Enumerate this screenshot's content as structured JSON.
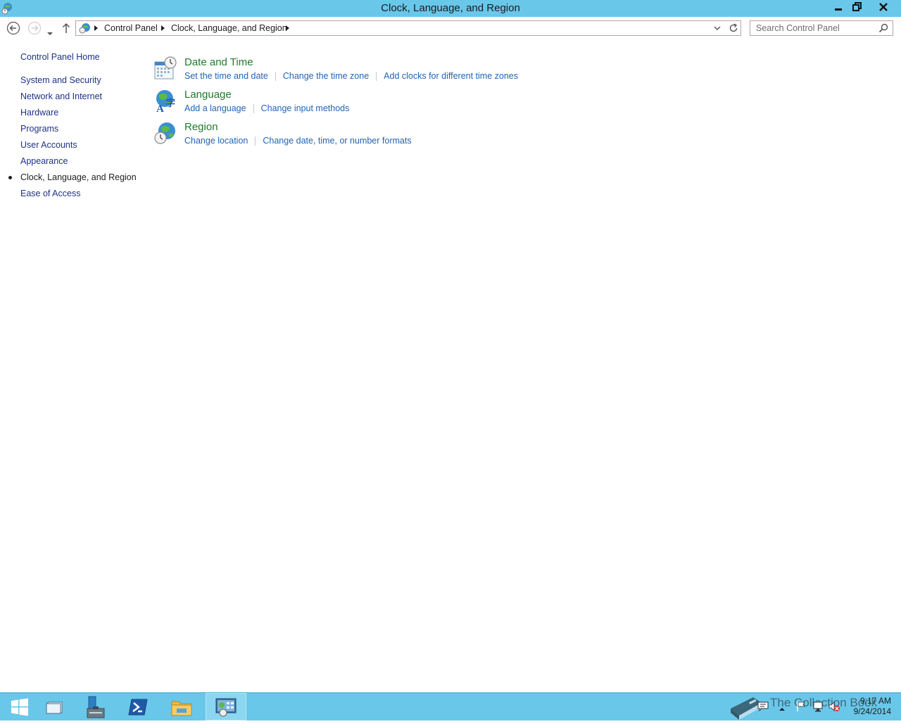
{
  "window": {
    "title": "Clock, Language, and Region"
  },
  "address": {
    "breadcrumbs": [
      "Control Panel",
      "Clock, Language, and Region"
    ]
  },
  "search": {
    "placeholder": "Search Control Panel"
  },
  "sidebar": {
    "items": [
      {
        "label": "Control Panel Home"
      },
      {
        "label": "System and Security"
      },
      {
        "label": "Network and Internet"
      },
      {
        "label": "Hardware"
      },
      {
        "label": "Programs"
      },
      {
        "label": "User Accounts"
      },
      {
        "label": "Appearance"
      },
      {
        "label": "Clock, Language, and Region",
        "current": true
      },
      {
        "label": "Ease of Access"
      }
    ]
  },
  "categories": [
    {
      "title": "Date and Time",
      "icon": "calendar-clock-icon",
      "links": [
        "Set the time and date",
        "Change the time zone",
        "Add clocks for different time zones"
      ]
    },
    {
      "title": "Language",
      "icon": "language-globe-icon",
      "links": [
        "Add a language",
        "Change input methods"
      ]
    },
    {
      "title": "Region",
      "icon": "region-globe-clock-icon",
      "links": [
        "Change location",
        "Change date, time, or number formats"
      ]
    }
  ],
  "taskbar": {
    "clock_time": "9:17 AM",
    "clock_date": "9/24/2014",
    "watermark": "The Collection Book"
  },
  "colors": {
    "titlebar": "#69c7ea",
    "category_title": "#1f7a2e",
    "link": "#1f64b4",
    "nav_link": "#1e3287"
  }
}
